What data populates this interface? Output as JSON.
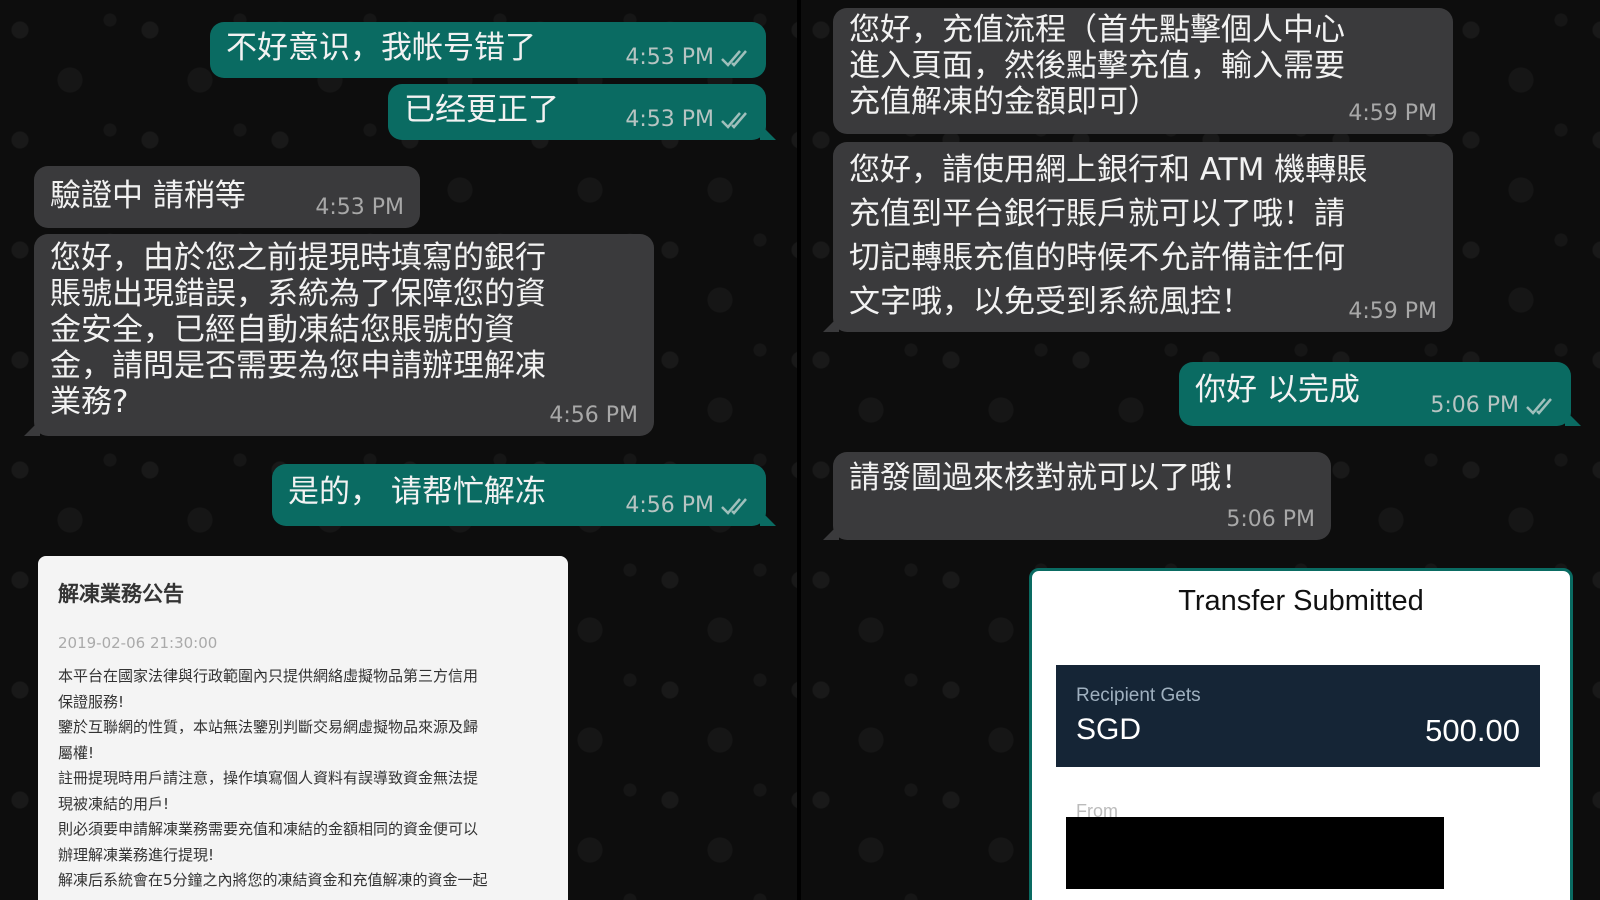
{
  "left_chat": {
    "m1": {
      "text": "不好意识，我帐号错了",
      "time": "4:53 PM"
    },
    "m2": {
      "text": "已经更正了",
      "time": "4:53 PM"
    },
    "m3": {
      "text": "驗證中 請稍等",
      "time": "4:53 PM"
    },
    "m4": {
      "text": "您好，由於您之前提現時填寫的銀行\n賬號出現錯誤，系統為了保障您的資\n金安全，已經自動凍結您賬號的資\n金，請問是否需要為您申請辦理解凍\n業務?",
      "time": "4:56 PM"
    },
    "m5": {
      "text": "是的， 请帮忙解冻",
      "time": "4:56 PM"
    }
  },
  "notice": {
    "title": "解凍業務公告",
    "date": "2019-02-06 21:30:00",
    "lines": [
      "本平台在國家法律與行政範圍內只提供網絡虛擬物品第三方信用",
      "保證服務!",
      "鑒於互聯網的性質，本站無法鑒別判斷交易網虛擬物品來源及歸",
      "屬權!",
      "註冊提現時用戶請注意，操作填寫個人資料有誤導致資金無法提",
      "現被凍結的用戶!",
      "則必須要申請解凍業務需要充值和凍結的金額相同的資金便可以",
      "辦理解凍業務進行提現!",
      "解凍后系統會在5分鐘之內將您的凍結資金和充值解凍的資金一起"
    ]
  },
  "right_chat": {
    "m1": {
      "text": "您好，充值流程（首先點擊個人中心\n進入頁面，然後點擊充值，輸入需要\n充值解凍的金額即可）",
      "time": "4:59 PM"
    },
    "m2": {
      "text": "您好，請使用網上銀行和 ATM 機轉賬\n充值到平台銀行賬戶就可以了哦！請\n切記轉賬充值的時候不允許備註任何\n文字哦，以免受到系統風控！",
      "time": "4:59 PM"
    },
    "m3": {
      "text": "你好 以完成",
      "time": "5:06 PM"
    },
    "m4": {
      "text": "請發圖過來核對就可以了哦！",
      "time": "5:06 PM"
    }
  },
  "transfer": {
    "title": "Transfer Submitted",
    "recipient_label": "Recipient Gets",
    "currency": "SGD",
    "amount": "500.00",
    "from_label": "From"
  },
  "colors": {
    "outgoing_bubble": "#0a6b62",
    "incoming_bubble": "#3a3a3c",
    "chat_background": "#0d0d0d"
  },
  "icons": {
    "read_receipt": "double-check-icon"
  }
}
